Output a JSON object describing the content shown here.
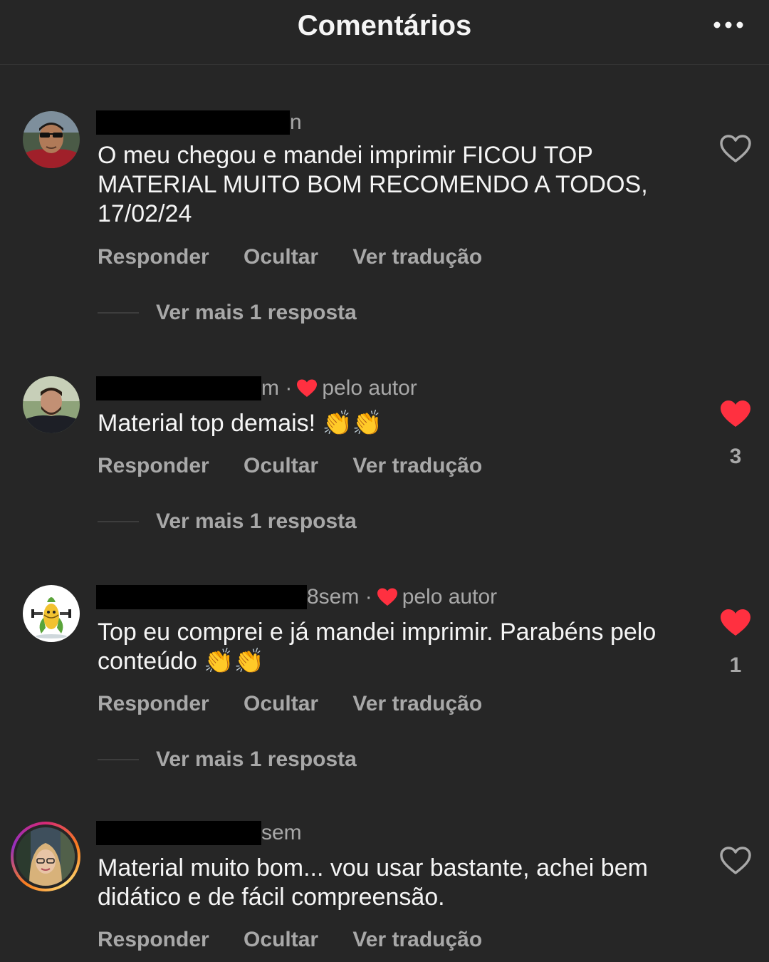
{
  "header": {
    "title": "Comentários"
  },
  "colors": {
    "background": "#262626",
    "text": "#f5f5f5",
    "muted": "#a8a8a8",
    "like": "#ff3040",
    "redaction": "#000000"
  },
  "icons": {
    "more": "more-horizontal-icon",
    "like": "heart-icon",
    "liked": "heart-filled-icon"
  },
  "comments": [
    {
      "meta_tail": "n",
      "text": "O meu chegou e mandei imprimir FICOU TOP MATERIAL MUITO BOM RECOMENDO A TODOS, 17/02/24",
      "actions": {
        "reply": "Responder",
        "hide": "Ocultar",
        "translate": "Ver tradução"
      },
      "replies": "Ver mais 1 resposta",
      "liked": false,
      "likes": ""
    },
    {
      "meta_tail": "m ·",
      "liked_by_author": "pelo autor",
      "text": "Material top demais! 👏👏",
      "actions": {
        "reply": "Responder",
        "hide": "Ocultar",
        "translate": "Ver tradução"
      },
      "replies": "Ver mais 1 resposta",
      "liked": true,
      "likes": "3"
    },
    {
      "meta_tail": "8sem ·",
      "liked_by_author": "pelo autor",
      "text": "Top eu comprei e já mandei imprimir. Parabéns pelo conteúdo 👏👏",
      "actions": {
        "reply": "Responder",
        "hide": "Ocultar",
        "translate": "Ver tradução"
      },
      "replies": "Ver mais 1 resposta",
      "liked": true,
      "likes": "1"
    },
    {
      "meta_tail": "sem",
      "text": "Material muito bom... vou usar bastante, achei bem didático e de fácil compreensão.",
      "actions": {
        "reply": "Responder",
        "hide": "Ocultar",
        "translate": "Ver tradução"
      },
      "liked": false,
      "likes": ""
    }
  ]
}
